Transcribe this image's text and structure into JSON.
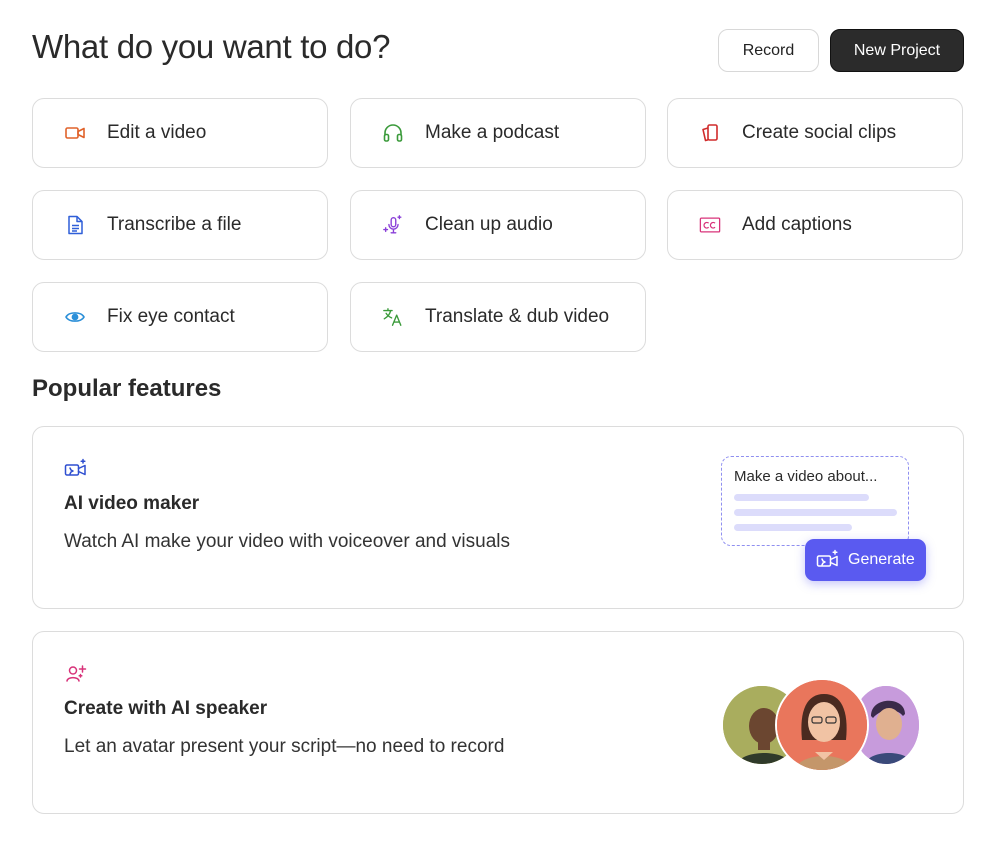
{
  "header": {
    "title": "What do you want to do?",
    "record_label": "Record",
    "new_project_label": "New Project"
  },
  "tasks": [
    {
      "label": "Edit a video",
      "icon": "video-camera-icon",
      "color": "#e0622a"
    },
    {
      "label": "Make a podcast",
      "icon": "headphones-icon",
      "color": "#3a9a3a"
    },
    {
      "label": "Create social clips",
      "icon": "social-clips-icon",
      "color": "#d02b2b"
    },
    {
      "label": "Transcribe a file",
      "icon": "document-icon",
      "color": "#2f5fd8"
    },
    {
      "label": "Clean up audio",
      "icon": "microphone-sparkle-icon",
      "color": "#8a3fd8"
    },
    {
      "label": "Add captions",
      "icon": "captions-icon",
      "color": "#d8337a"
    },
    {
      "label": "Fix eye contact",
      "icon": "eye-icon",
      "color": "#2b8fd8"
    },
    {
      "label": "Translate & dub video",
      "icon": "translate-icon",
      "color": "#3a9a3a"
    }
  ],
  "popular": {
    "title": "Popular features",
    "ai_video": {
      "title": "AI video maker",
      "description": "Watch AI make your video with voiceover and visuals",
      "prompt_text": "Make a video about...",
      "generate_label": "Generate",
      "icon": "ai-video-camera-icon"
    },
    "ai_speaker": {
      "title": "Create with AI speaker",
      "description": "Let an avatar present your script—no need to record",
      "icon": "ai-speaker-icon"
    }
  },
  "colors": {
    "accent": "#5a5af0",
    "dark_button": "#2b2b2b"
  }
}
